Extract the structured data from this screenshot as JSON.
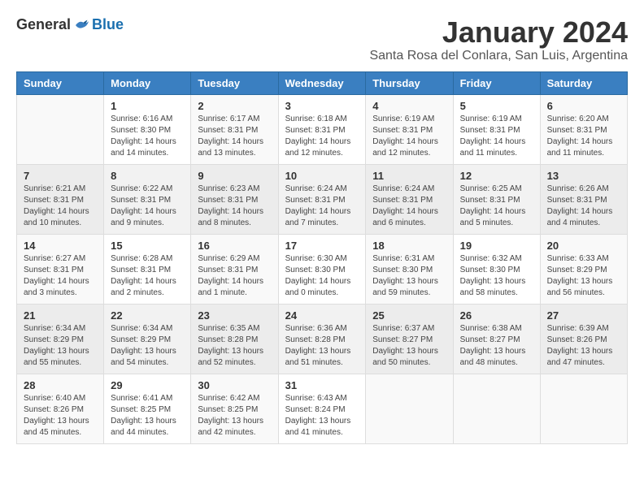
{
  "logo": {
    "general": "General",
    "blue": "Blue"
  },
  "title": "January 2024",
  "subtitle": "Santa Rosa del Conlara, San Luis, Argentina",
  "days_of_week": [
    "Sunday",
    "Monday",
    "Tuesday",
    "Wednesday",
    "Thursday",
    "Friday",
    "Saturday"
  ],
  "weeks": [
    [
      {
        "day": "",
        "info": ""
      },
      {
        "day": "1",
        "info": "Sunrise: 6:16 AM\nSunset: 8:30 PM\nDaylight: 14 hours\nand 14 minutes."
      },
      {
        "day": "2",
        "info": "Sunrise: 6:17 AM\nSunset: 8:31 PM\nDaylight: 14 hours\nand 13 minutes."
      },
      {
        "day": "3",
        "info": "Sunrise: 6:18 AM\nSunset: 8:31 PM\nDaylight: 14 hours\nand 12 minutes."
      },
      {
        "day": "4",
        "info": "Sunrise: 6:19 AM\nSunset: 8:31 PM\nDaylight: 14 hours\nand 12 minutes."
      },
      {
        "day": "5",
        "info": "Sunrise: 6:19 AM\nSunset: 8:31 PM\nDaylight: 14 hours\nand 11 minutes."
      },
      {
        "day": "6",
        "info": "Sunrise: 6:20 AM\nSunset: 8:31 PM\nDaylight: 14 hours\nand 11 minutes."
      }
    ],
    [
      {
        "day": "7",
        "info": "Sunrise: 6:21 AM\nSunset: 8:31 PM\nDaylight: 14 hours\nand 10 minutes."
      },
      {
        "day": "8",
        "info": "Sunrise: 6:22 AM\nSunset: 8:31 PM\nDaylight: 14 hours\nand 9 minutes."
      },
      {
        "day": "9",
        "info": "Sunrise: 6:23 AM\nSunset: 8:31 PM\nDaylight: 14 hours\nand 8 minutes."
      },
      {
        "day": "10",
        "info": "Sunrise: 6:24 AM\nSunset: 8:31 PM\nDaylight: 14 hours\nand 7 minutes."
      },
      {
        "day": "11",
        "info": "Sunrise: 6:24 AM\nSunset: 8:31 PM\nDaylight: 14 hours\nand 6 minutes."
      },
      {
        "day": "12",
        "info": "Sunrise: 6:25 AM\nSunset: 8:31 PM\nDaylight: 14 hours\nand 5 minutes."
      },
      {
        "day": "13",
        "info": "Sunrise: 6:26 AM\nSunset: 8:31 PM\nDaylight: 14 hours\nand 4 minutes."
      }
    ],
    [
      {
        "day": "14",
        "info": "Sunrise: 6:27 AM\nSunset: 8:31 PM\nDaylight: 14 hours\nand 3 minutes."
      },
      {
        "day": "15",
        "info": "Sunrise: 6:28 AM\nSunset: 8:31 PM\nDaylight: 14 hours\nand 2 minutes."
      },
      {
        "day": "16",
        "info": "Sunrise: 6:29 AM\nSunset: 8:31 PM\nDaylight: 14 hours\nand 1 minute."
      },
      {
        "day": "17",
        "info": "Sunrise: 6:30 AM\nSunset: 8:30 PM\nDaylight: 14 hours\nand 0 minutes."
      },
      {
        "day": "18",
        "info": "Sunrise: 6:31 AM\nSunset: 8:30 PM\nDaylight: 13 hours\nand 59 minutes."
      },
      {
        "day": "19",
        "info": "Sunrise: 6:32 AM\nSunset: 8:30 PM\nDaylight: 13 hours\nand 58 minutes."
      },
      {
        "day": "20",
        "info": "Sunrise: 6:33 AM\nSunset: 8:29 PM\nDaylight: 13 hours\nand 56 minutes."
      }
    ],
    [
      {
        "day": "21",
        "info": "Sunrise: 6:34 AM\nSunset: 8:29 PM\nDaylight: 13 hours\nand 55 minutes."
      },
      {
        "day": "22",
        "info": "Sunrise: 6:34 AM\nSunset: 8:29 PM\nDaylight: 13 hours\nand 54 minutes."
      },
      {
        "day": "23",
        "info": "Sunrise: 6:35 AM\nSunset: 8:28 PM\nDaylight: 13 hours\nand 52 minutes."
      },
      {
        "day": "24",
        "info": "Sunrise: 6:36 AM\nSunset: 8:28 PM\nDaylight: 13 hours\nand 51 minutes."
      },
      {
        "day": "25",
        "info": "Sunrise: 6:37 AM\nSunset: 8:27 PM\nDaylight: 13 hours\nand 50 minutes."
      },
      {
        "day": "26",
        "info": "Sunrise: 6:38 AM\nSunset: 8:27 PM\nDaylight: 13 hours\nand 48 minutes."
      },
      {
        "day": "27",
        "info": "Sunrise: 6:39 AM\nSunset: 8:26 PM\nDaylight: 13 hours\nand 47 minutes."
      }
    ],
    [
      {
        "day": "28",
        "info": "Sunrise: 6:40 AM\nSunset: 8:26 PM\nDaylight: 13 hours\nand 45 minutes."
      },
      {
        "day": "29",
        "info": "Sunrise: 6:41 AM\nSunset: 8:25 PM\nDaylight: 13 hours\nand 44 minutes."
      },
      {
        "day": "30",
        "info": "Sunrise: 6:42 AM\nSunset: 8:25 PM\nDaylight: 13 hours\nand 42 minutes."
      },
      {
        "day": "31",
        "info": "Sunrise: 6:43 AM\nSunset: 8:24 PM\nDaylight: 13 hours\nand 41 minutes."
      },
      {
        "day": "",
        "info": ""
      },
      {
        "day": "",
        "info": ""
      },
      {
        "day": "",
        "info": ""
      }
    ]
  ]
}
